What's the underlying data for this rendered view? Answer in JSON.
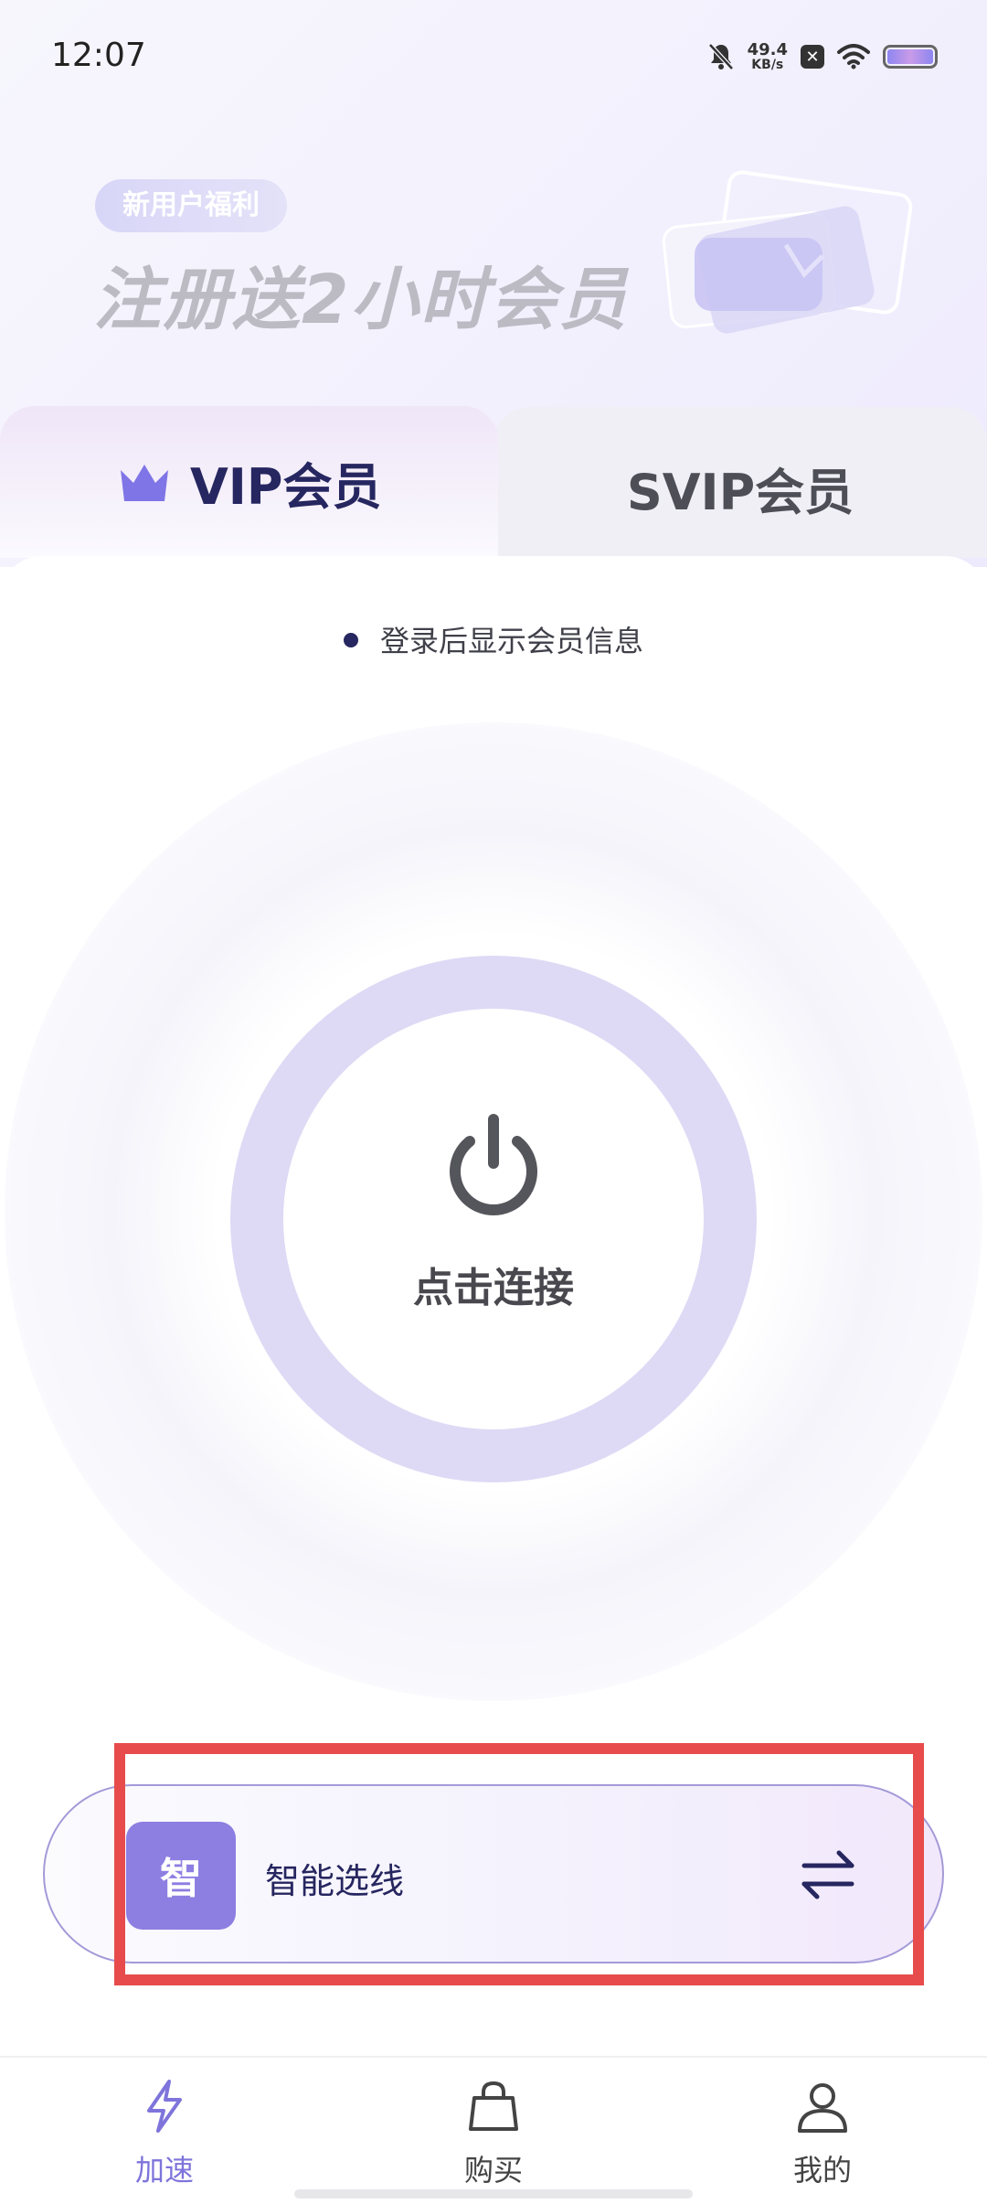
{
  "status_bar": {
    "time": "12:07",
    "net_speed_value": "49.4",
    "net_speed_unit": "KB/s",
    "icons": [
      "mute-bell-icon",
      "x-notification-icon",
      "wifi-icon",
      "battery-icon"
    ]
  },
  "promo": {
    "tag": "新用户福利",
    "title": "注册送2小时会员"
  },
  "tabs": [
    {
      "label": "VIP会员",
      "icon": "crown-icon",
      "active": true
    },
    {
      "label": "SVIP会员",
      "active": false
    }
  ],
  "login_info": "登录后显示会员信息",
  "connect": {
    "label": "点击连接",
    "icon": "power-icon"
  },
  "line_selector": {
    "badge": "智",
    "label": "智能选线",
    "icon": "swap-arrows-icon"
  },
  "bottom_nav": [
    {
      "label": "加速",
      "icon": "lightning-icon",
      "active": true
    },
    {
      "label": "购买",
      "icon": "shopping-bag-icon",
      "active": false
    },
    {
      "label": "我的",
      "icon": "user-icon",
      "active": false
    }
  ],
  "colors": {
    "accent": "#8d7ee2",
    "active_nav": "#7e74db",
    "ring": "#dedaf5",
    "highlight": "#e74b4b",
    "dark_text": "#262660"
  }
}
